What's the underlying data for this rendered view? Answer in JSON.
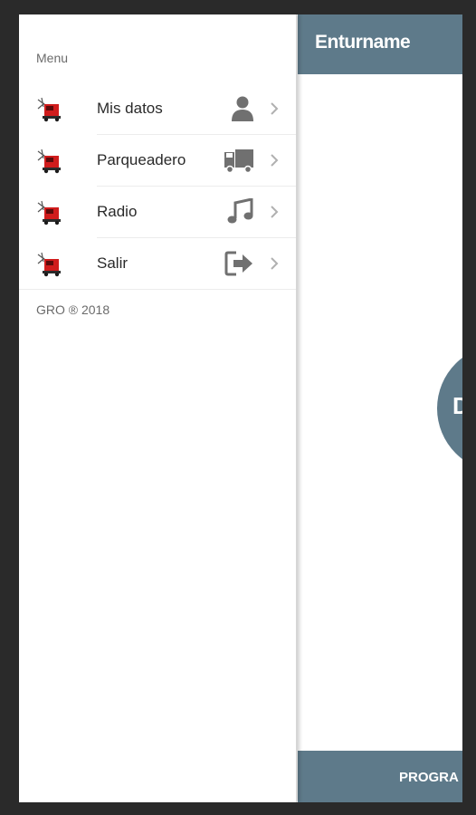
{
  "app": {
    "title": "Enturname",
    "fab_label": "D",
    "footer_label": "PROGRA",
    "accent_color": "#5e7a8a"
  },
  "drawer": {
    "heading": "Menu",
    "items": [
      {
        "label": "Mis datos",
        "thumb": "truck-photo-thumb",
        "icon": "user-icon"
      },
      {
        "label": "Parqueadero",
        "thumb": "truck-photo-thumb",
        "icon": "truck-icon"
      },
      {
        "label": "Radio",
        "thumb": "truck-photo-thumb",
        "icon": "music-note-icon"
      },
      {
        "label": "Salir",
        "thumb": "truck-photo-thumb",
        "icon": "sign-out-icon"
      }
    ],
    "copyright": "GRO ® 2018"
  }
}
